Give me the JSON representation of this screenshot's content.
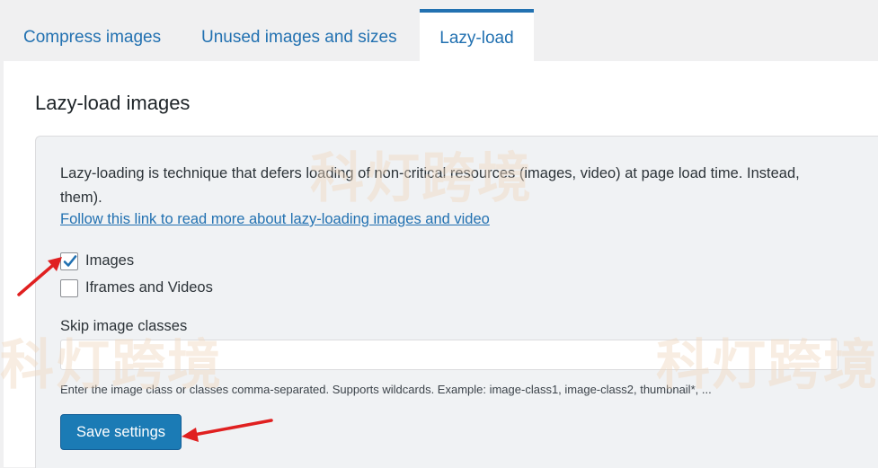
{
  "tabs": [
    {
      "label": "Compress images",
      "active": false
    },
    {
      "label": "Unused images and sizes",
      "active": false
    },
    {
      "label": "Lazy-load",
      "active": true
    }
  ],
  "page": {
    "title": "Lazy-load images",
    "description_line1": "Lazy-loading is technique that defers loading of non-critical resources (images, video) at page load time. Instead,",
    "description_line2": "them).",
    "link_text": "Follow this link to read more about lazy-loading images and video"
  },
  "options": {
    "images": {
      "label": "Images",
      "checked": true
    },
    "iframes": {
      "label": "Iframes and Videos",
      "checked": false
    }
  },
  "skip_classes": {
    "label": "Skip image classes",
    "value": "",
    "hint": "Enter the image class or classes comma-separated. Supports wildcards. Example: image-class1, image-class2, thumbnail*, ..."
  },
  "save_label": "Save settings",
  "watermark": "科灯跨境",
  "colors": {
    "accent": "#2271b1",
    "button": "#1b7bb5",
    "arrow": "#e02020"
  }
}
